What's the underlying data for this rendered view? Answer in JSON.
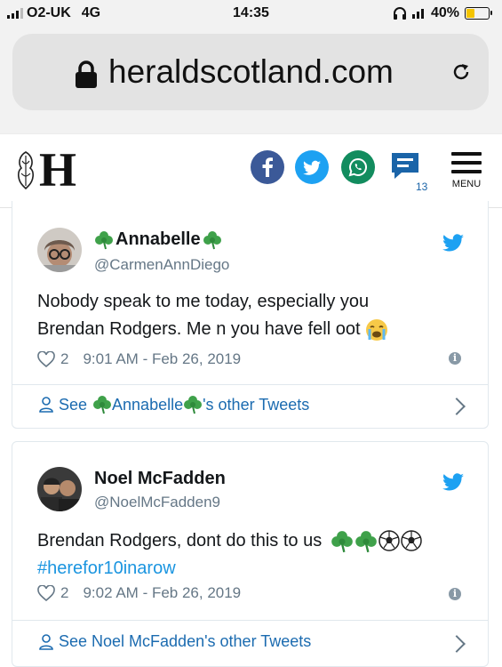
{
  "status_bar": {
    "carrier": "O2-UK",
    "network": "4G",
    "time": "14:35",
    "battery": "40%",
    "battery_level": 0.4
  },
  "browser": {
    "url": "heraldscotland.com"
  },
  "site_header": {
    "logo_letter": "H",
    "comment_count": "13",
    "menu_label": "MENU"
  },
  "tweets": [
    {
      "display_name": "Annabelle",
      "handle": "@CarmenAnnDiego",
      "text_line1": "Nobody speak to me today, especially you",
      "text_line2": "Brendan Rodgers. Me n you have fell oot",
      "likes": "2",
      "timestamp": "9:01 AM - Feb 26, 2019",
      "see_prefix": "See",
      "see_name": "Annabelle",
      "see_suffix": "'s other Tweets"
    },
    {
      "display_name": "Noel McFadden",
      "handle": "@NoelMcFadden9",
      "text_line1": "Brendan Rodgers, dont do this to us",
      "hashtag": "#herefor10inarow",
      "likes": "2",
      "timestamp": "9:02 AM - Feb 26, 2019",
      "see_text": "See Noel McFadden's other Tweets"
    }
  ],
  "colors": {
    "twitter_blue": "#1da1f2",
    "facebook": "#3b5998",
    "whatsapp": "#128c5e",
    "link": "#1b6bb0",
    "clover": "#3fa14a"
  },
  "icons": [
    "signal-icon",
    "headphones-icon",
    "battery-icon",
    "lock-icon",
    "reload-icon",
    "facebook-icon",
    "twitter-icon",
    "whatsapp-icon",
    "comment-icon",
    "menu-icon",
    "twitter-bird-icon",
    "heart-icon",
    "info-icon",
    "person-icon",
    "chevron-right-icon",
    "shamrock-icon",
    "football-icon",
    "crying-face-icon"
  ]
}
